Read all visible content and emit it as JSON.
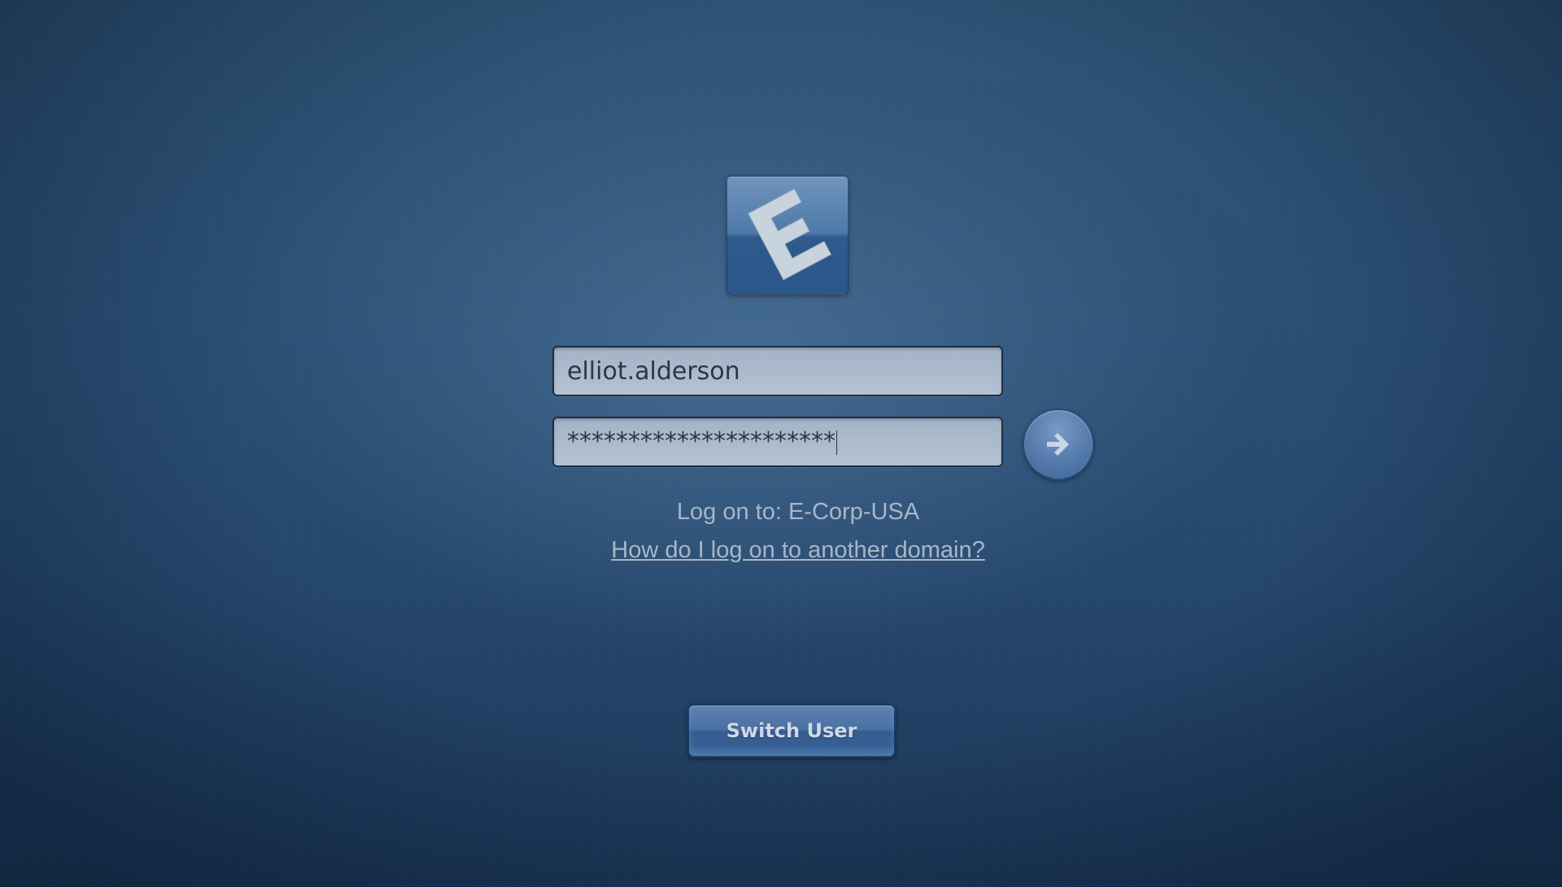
{
  "logo": {
    "letter": "E",
    "icon": "e-corp-logo",
    "colors": {
      "tile": "#4f79a8",
      "letter": "#c8d3de"
    }
  },
  "login": {
    "username": "elliot.alderson",
    "password_masked": "**********************",
    "submit_icon": "arrow-right-icon"
  },
  "domain": {
    "logon_text": "Log on to: E-Corp-USA",
    "help_link": "How do I log on to another domain?"
  },
  "switch_user": {
    "label": "Switch User"
  },
  "colors": {
    "background": "#2a4f74",
    "field_bg": "#b0bfcf",
    "text_light": "#a7b6c8"
  }
}
